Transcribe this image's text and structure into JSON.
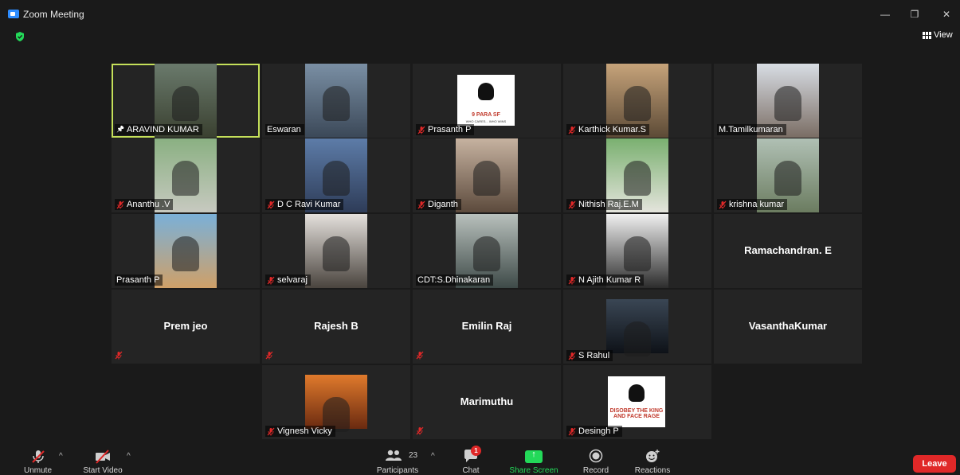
{
  "window": {
    "title": "Zoom Meeting",
    "minimize": "—",
    "restore": "❐",
    "close": "✕"
  },
  "view": {
    "label": "View"
  },
  "tiles": [
    {
      "name": "ARAVIND KUMAR",
      "muted": false,
      "pinned": true,
      "video": "video",
      "active": true
    },
    {
      "name": "Eswaran",
      "muted": false,
      "video": "video"
    },
    {
      "name": "Prasanth P",
      "muted": true,
      "video": "logo",
      "logo_text": "9 PARA SF",
      "logo_sub": "WHO CARES... WHO WINS"
    },
    {
      "name": "Karthick Kumar.S",
      "muted": true,
      "video": "video"
    },
    {
      "name": "M.Tamilkumaran",
      "muted": false,
      "video": "video"
    },
    {
      "name": "Ananthu .V",
      "muted": true,
      "video": "video"
    },
    {
      "name": "D C Ravi Kumar",
      "muted": true,
      "video": "video"
    },
    {
      "name": "Diganth",
      "muted": true,
      "video": "video"
    },
    {
      "name": "Nithish Raj.E.M",
      "muted": true,
      "video": "video"
    },
    {
      "name": "krishna kumar",
      "muted": true,
      "video": "video"
    },
    {
      "name": "Prasanth P",
      "muted": false,
      "video": "video"
    },
    {
      "name": "selvaraj",
      "muted": true,
      "video": "video"
    },
    {
      "name": "CDT:S.Dhinakaran",
      "muted": false,
      "video": "video"
    },
    {
      "name": "N Ajith Kumar R",
      "muted": true,
      "video": "video"
    },
    {
      "name": "Ramachandran. E",
      "muted": false,
      "video": "none"
    },
    {
      "name": "Prem jeo",
      "muted": true,
      "video": "none"
    },
    {
      "name": "Rajesh B",
      "muted": true,
      "video": "none"
    },
    {
      "name": "Emilin Raj",
      "muted": true,
      "video": "none"
    },
    {
      "name": "S Rahul",
      "muted": true,
      "video": "image"
    },
    {
      "name": "VasanthaKumar",
      "muted": false,
      "video": "none"
    },
    {
      "name": "Vignesh Vicky",
      "muted": true,
      "video": "image"
    },
    {
      "name": "Marimuthu",
      "muted": true,
      "video": "none"
    },
    {
      "name": "Desingh P",
      "muted": true,
      "video": "logo",
      "logo_text": "DISOBEY THE KING AND FACE RAGE"
    }
  ],
  "toolbar": {
    "unmute": "Unmute",
    "start_video": "Start Video",
    "participants": "Participants",
    "participants_count": "23",
    "chat": "Chat",
    "chat_badge": "1",
    "share_screen": "Share Screen",
    "record": "Record",
    "reactions": "Reactions",
    "leave": "Leave"
  },
  "colors": {
    "accent_share": "#23d959",
    "leave": "#e02828",
    "active_speaker": "#c5e05a",
    "share_label": "#23d959"
  }
}
